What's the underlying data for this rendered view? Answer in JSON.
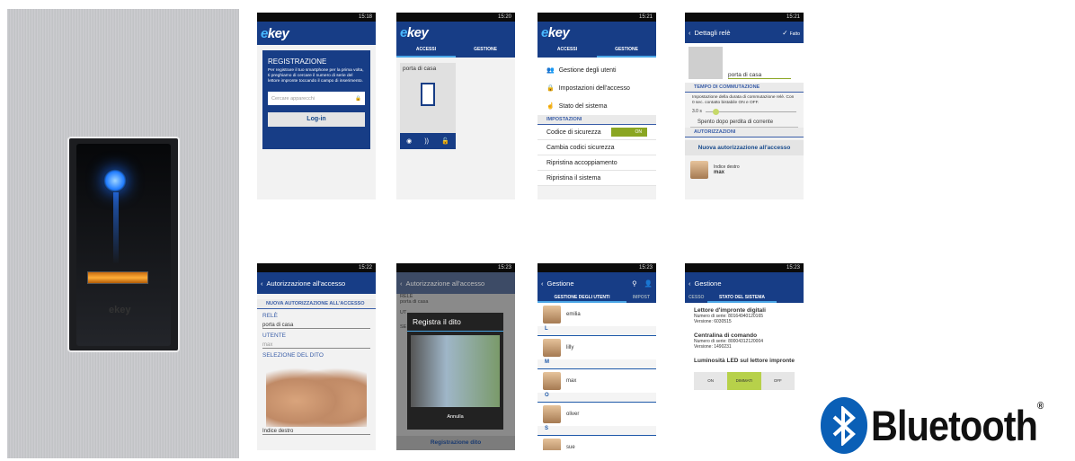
{
  "device": {
    "brand": "ekey"
  },
  "s1": {
    "status": "15:18",
    "logo_e": "e",
    "logo_key": "key",
    "title": "REGISTRAZIONE",
    "desc": "Per registrare il tuo smartphone per la prima volta, ti preghiamo di cercare il numero di serie del lettore impronte toccando il campo di inserimento.",
    "placeholder": "Cercare apparecchi",
    "login": "Log-in"
  },
  "s2": {
    "status": "15:20",
    "tab1": "ACCESSI",
    "tab2": "GESTIONE",
    "door_label": "porta di casa"
  },
  "s3": {
    "status": "15:21",
    "tab1": "ACCESSI",
    "tab2": "GESTIONE",
    "items": [
      "Gestione degli utenti",
      "Impostazioni dell'accesso",
      "Stato del sistema"
    ],
    "section": "IMPOSTAZIONI",
    "code_label": "Codice di sicurezza",
    "code_toggle": "ON",
    "items2": [
      "Cambia codici sicurezza",
      "Ripristina accoppiamento",
      "Ripristina il sistema"
    ]
  },
  "s4": {
    "status": "15:21",
    "title": "Dettagli relè",
    "done": "Fatto",
    "door_label": "porta di casa",
    "sec1": "TEMPO DI COMMUTAZIONE",
    "desc": "Impostazione della durata di commutazione relè. Con 0 sec. contatto bistabile ON e OFF.",
    "val": "3.0 s",
    "dropdown": "Spento dopo perdita di corrente",
    "sec2": "AUTORIZZAZIONI",
    "btn": "Nuova autorizzazione all'accesso",
    "finger": "Indice destro",
    "user": "max"
  },
  "s5": {
    "status": "15:22",
    "title": "Autorizzazione all'accesso",
    "sec": "NUOVA AUTORIZZAZIONE ALL'ACCESSO",
    "rele_label": "RELÈ",
    "rele_val": "porta di casa",
    "user_label": "UTENTE",
    "user_val": "max",
    "finger_label": "SELEZIONE DEL DITO",
    "finger_val": "Indice destro"
  },
  "s6": {
    "status": "15:23",
    "title": "Autorizzazione all'accesso",
    "bg1": "RELÈ",
    "bg2": "porta di casa",
    "bg3": "UT",
    "bg4": "SE",
    "dialog": "Registra il dito",
    "cancel": "Annulla",
    "bottom": "Registrazione dito"
  },
  "s7": {
    "status": "15:23",
    "title": "Gestione",
    "tab1": "GESTIONE DEGLI UTENTI",
    "tab2": "IMPOST",
    "contacts": [
      {
        "letter": "",
        "name": "emilia"
      },
      {
        "letter": "L",
        "name": "lilly"
      },
      {
        "letter": "M",
        "name": "max"
      },
      {
        "letter": "O",
        "name": "oliver"
      },
      {
        "letter": "S",
        "name": "sue"
      }
    ]
  },
  "s8": {
    "status": "15:23",
    "title": "Gestione",
    "tab0": "CESSO",
    "tab1": "STATO DEL SISTEMA",
    "h1": "Lettore d'impronte digitali",
    "l1a": "Numero di serie: 80164940120165",
    "l1b": "Versione: 6030515",
    "h2": "Centralina di comando",
    "l2a": "Numero di serie: 80004312120004",
    "l2b": "Versione: 1490231",
    "h3": "Luminosità LED sul lettore impronte",
    "opt1": "ON",
    "opt2": "DIMMATI",
    "opt3": "OFF"
  },
  "bluetooth": {
    "word": "Bluetooth",
    "reg": "®"
  }
}
